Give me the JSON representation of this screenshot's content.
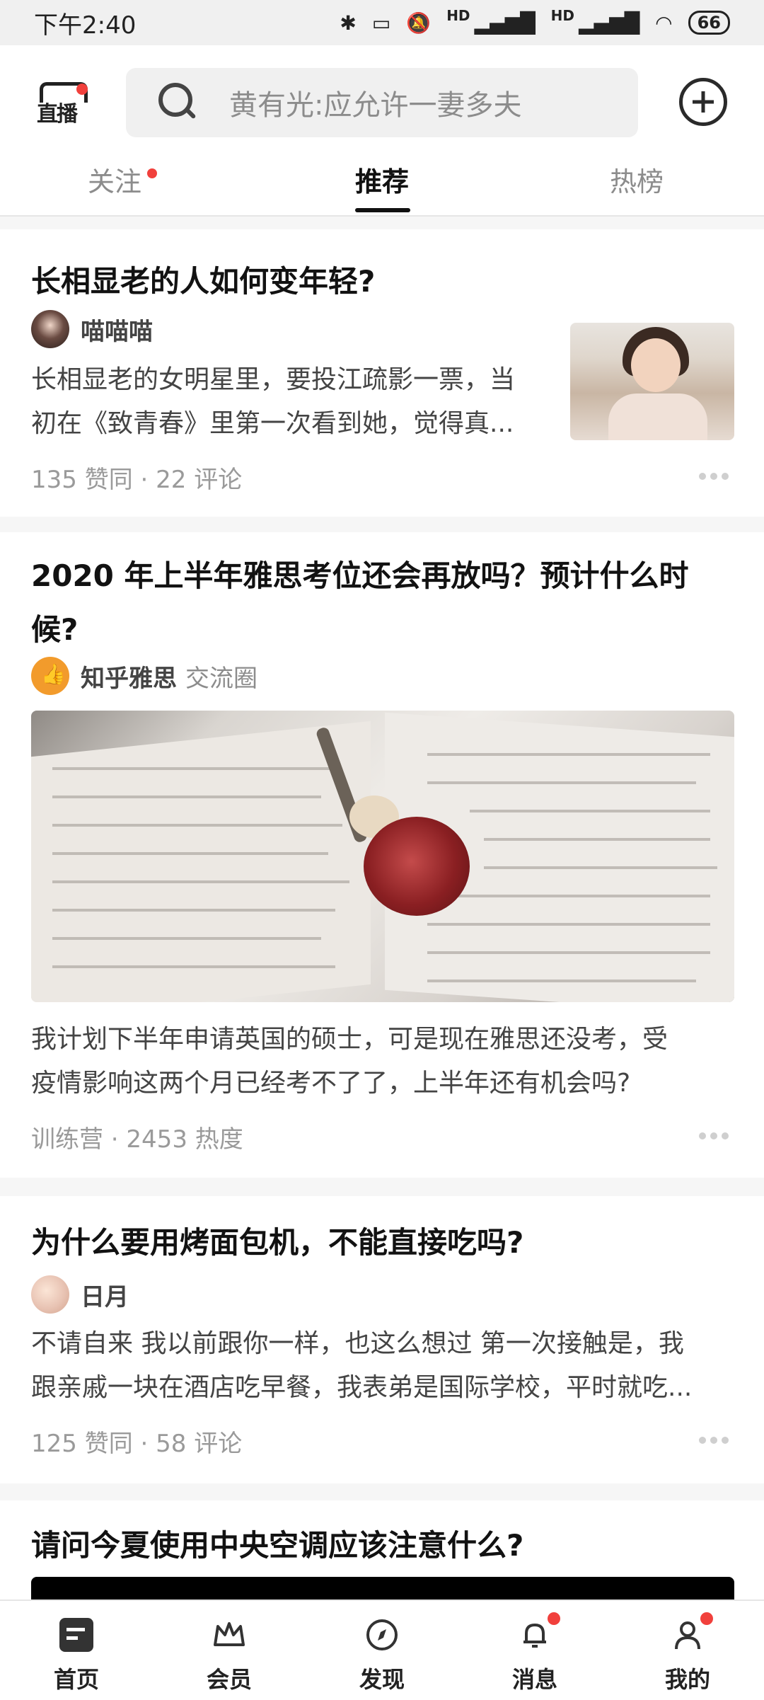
{
  "status_bar": {
    "time": "下午2:40",
    "signal_label_1": "HD",
    "signal_label_2": "HD",
    "battery": "66"
  },
  "header": {
    "live_logo_text": "直播",
    "search_placeholder": "黄有光:应允许一妻多夫",
    "tabs": [
      "关注",
      "推荐",
      "热榜"
    ]
  },
  "feed": [
    {
      "title": "长相显老的人如何变年轻?",
      "author": "喵喵喵",
      "excerpt_line1": "长相显老的女明星里，要投江疏影一票，当",
      "excerpt_line2": "初在《致青春》里第一次看到她，觉得真...",
      "meta": "135 赞同 · 22 评论"
    },
    {
      "title_line1": "2020 年上半年雅思考位还会再放吗？预计什么时",
      "title_line2": "候?",
      "author": "知乎雅思",
      "author_tag": "交流圈",
      "excerpt_line1": "我计划下半年申请英国的硕士，可是现在雅思还没考，受",
      "excerpt_line2": "疫情影响这两个月已经考不了了，上半年还有机会吗?",
      "meta": "训练营 · 2453 热度"
    },
    {
      "title": "为什么要用烤面包机，不能直接吃吗?",
      "author": "日月",
      "excerpt_line1": "不请自来 我以前跟你一样，也这么想过 第一次接触是，我",
      "excerpt_line2": "跟亲戚一块在酒店吃早餐，我表弟是国际学校，平时就吃...",
      "meta": "125 赞同 · 58 评论"
    },
    {
      "title": "请问今夏使用中央空调应该注意什么?"
    }
  ],
  "bottom_nav": [
    {
      "label": "首页",
      "icon": "home-icon"
    },
    {
      "label": "会员",
      "icon": "crown-icon"
    },
    {
      "label": "发现",
      "icon": "compass-icon"
    },
    {
      "label": "消息",
      "icon": "bell-icon"
    },
    {
      "label": "我的",
      "icon": "person-icon"
    }
  ],
  "colors": {
    "accent_red": "#f1403c",
    "text_primary": "#121212",
    "text_secondary": "#8c8c8c"
  }
}
